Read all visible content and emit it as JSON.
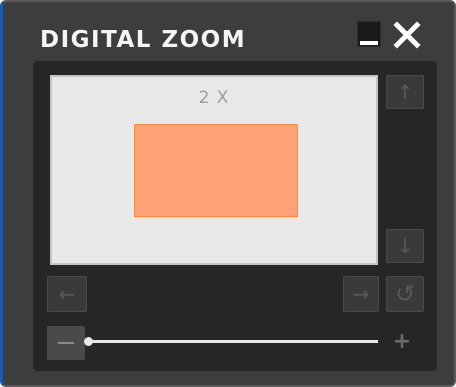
{
  "window": {
    "title": "DIGITAL ZOOM",
    "minimize_icon": "minimize-icon",
    "close_icon": "close-x-icon"
  },
  "viewport": {
    "zoom_label": "2 X"
  },
  "nav": {
    "up": "↑",
    "down": "↓",
    "left": "←",
    "right": "→",
    "reset": "↺"
  },
  "zoom_slider": {
    "minus": "−",
    "plus": "+",
    "level_fraction": 0.0
  },
  "colors": {
    "window_bg": "#3d3d3d",
    "panel_bg": "#262626",
    "viewport_bg": "#e8e8e8",
    "zoom_region": "#ffa277",
    "zoom_region_border": "#f08d3a",
    "accent_border": "#1e5aa8"
  }
}
